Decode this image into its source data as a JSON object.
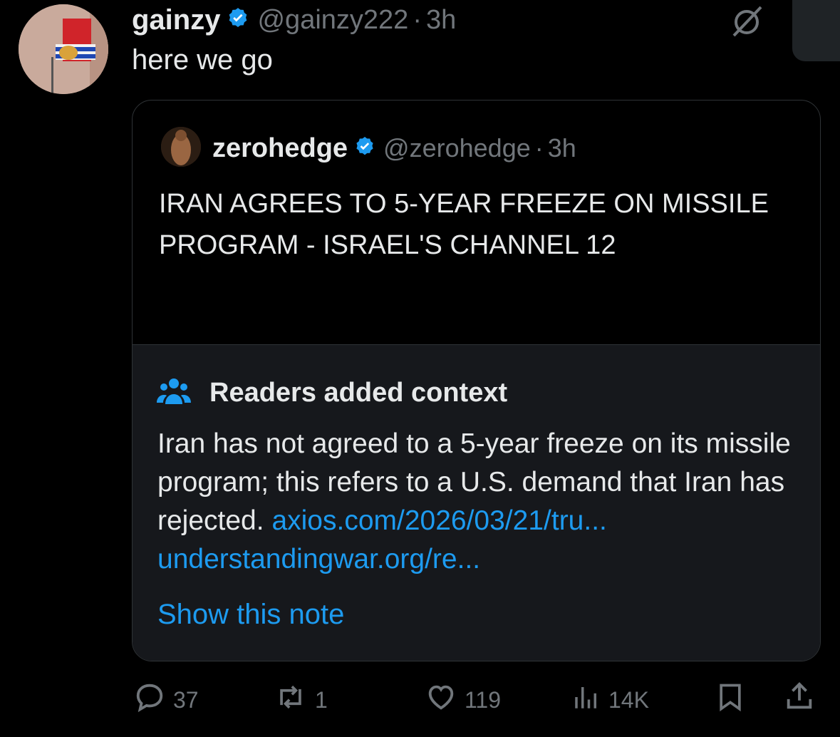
{
  "tweet": {
    "author_name": "gainzy",
    "author_handle": "@gainzy222",
    "separator": "·",
    "time": "3h",
    "text": "here we go"
  },
  "quoted": {
    "author_name": "zerohedge",
    "author_handle": "@zerohedge",
    "separator": "·",
    "time": "3h",
    "text": "IRAN AGREES TO 5-YEAR FREEZE ON MISSILE PROGRAM - ISRAEL'S CHANNEL 12"
  },
  "note": {
    "title": "Readers added context",
    "text": "Iran has not agreed to a 5-year freeze on its missile program; this refers to a U.S. demand that Iran has rejected.",
    "link1": "axios.com/2026/03/21/tru...",
    "link2": "understandingwar.org/re...",
    "show_label": "Show this note"
  },
  "actions": {
    "replies": "37",
    "reposts": "1",
    "likes": "119",
    "views": "14K"
  },
  "colors": {
    "accent": "#1d9bf0",
    "muted": "#71767b",
    "text": "#e7e9ea",
    "background": "#000000",
    "note_background": "#16181c"
  },
  "icons": [
    "verified-badge-icon",
    "grok-icon",
    "community-notes-icon",
    "reply-icon",
    "repost-icon",
    "like-icon",
    "views-icon",
    "bookmark-icon",
    "share-icon"
  ]
}
